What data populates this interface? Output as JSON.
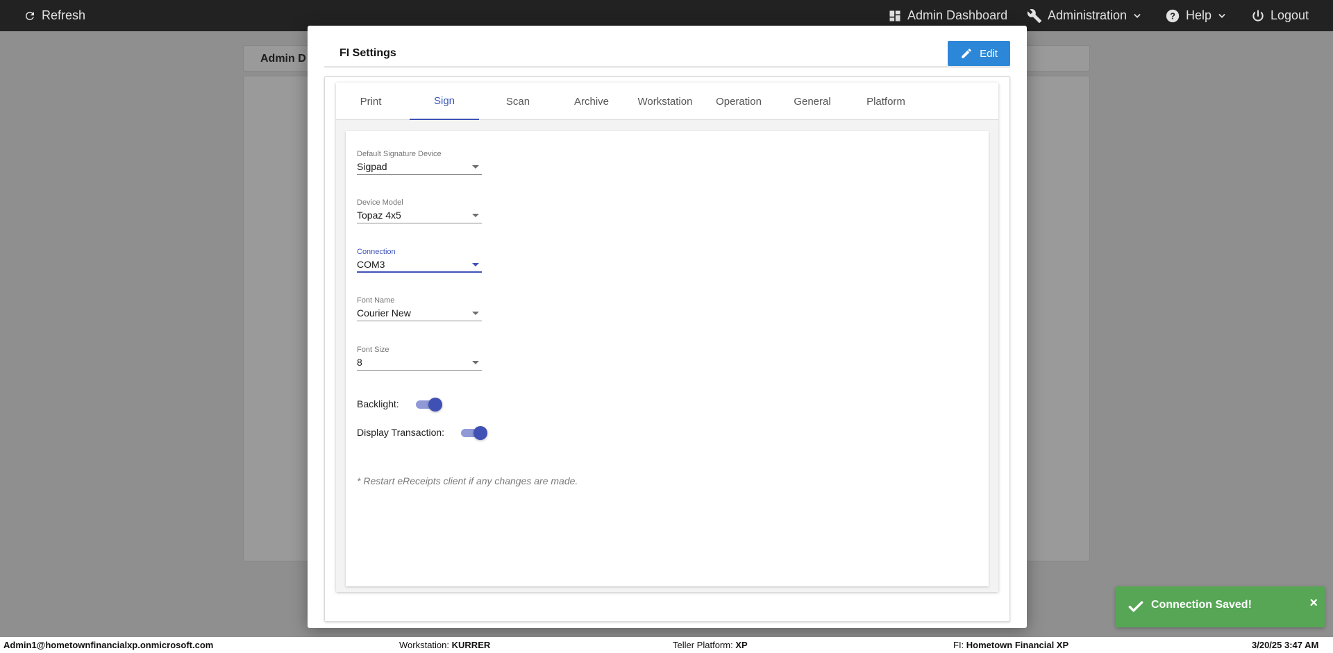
{
  "topbar": {
    "refresh_label": "Refresh",
    "admin_dashboard_label": "Admin Dashboard",
    "administration_label": "Administration",
    "help_label": "Help",
    "logout_label": "Logout"
  },
  "background": {
    "tab_title": "Admin D"
  },
  "modal": {
    "title": "FI Settings",
    "edit_label": "Edit",
    "tabs": [
      {
        "label": "Print"
      },
      {
        "label": "Sign"
      },
      {
        "label": "Scan"
      },
      {
        "label": "Archive"
      },
      {
        "label": "Workstation"
      },
      {
        "label": "Operation"
      },
      {
        "label": "General"
      },
      {
        "label": "Platform"
      }
    ],
    "active_tab": "Sign",
    "fields": [
      {
        "label": "Default Signature Device",
        "value": "Sigpad"
      },
      {
        "label": "Device Model",
        "value": "Topaz 4x5"
      },
      {
        "label": "Connection",
        "value": "COM3"
      },
      {
        "label": "Font Name",
        "value": "Courier New"
      },
      {
        "label": "Font Size",
        "value": "8"
      }
    ],
    "toggles": [
      {
        "label": "Backlight:",
        "on": true
      },
      {
        "label": "Display Transaction:",
        "on": true
      }
    ],
    "note": "* Restart eReceipts client if any changes are made."
  },
  "toast": {
    "message": "Connection Saved!",
    "close": "×"
  },
  "statusbar": {
    "user": "Admin1@hometownfinancialxp.onmicrosoft.com",
    "workstation_label": "Workstation:",
    "workstation_value": "KURRER",
    "platform_label": "Teller Platform:",
    "platform_value": "XP",
    "fi_label": "FI:",
    "fi_value": "Hometown Financial XP",
    "datetime": "3/20/25 3:47 AM"
  },
  "colors": {
    "accent": "#3f51b5",
    "edit_button": "#2d87d8",
    "toast_success": "#56a655",
    "topbar": "#222222"
  }
}
